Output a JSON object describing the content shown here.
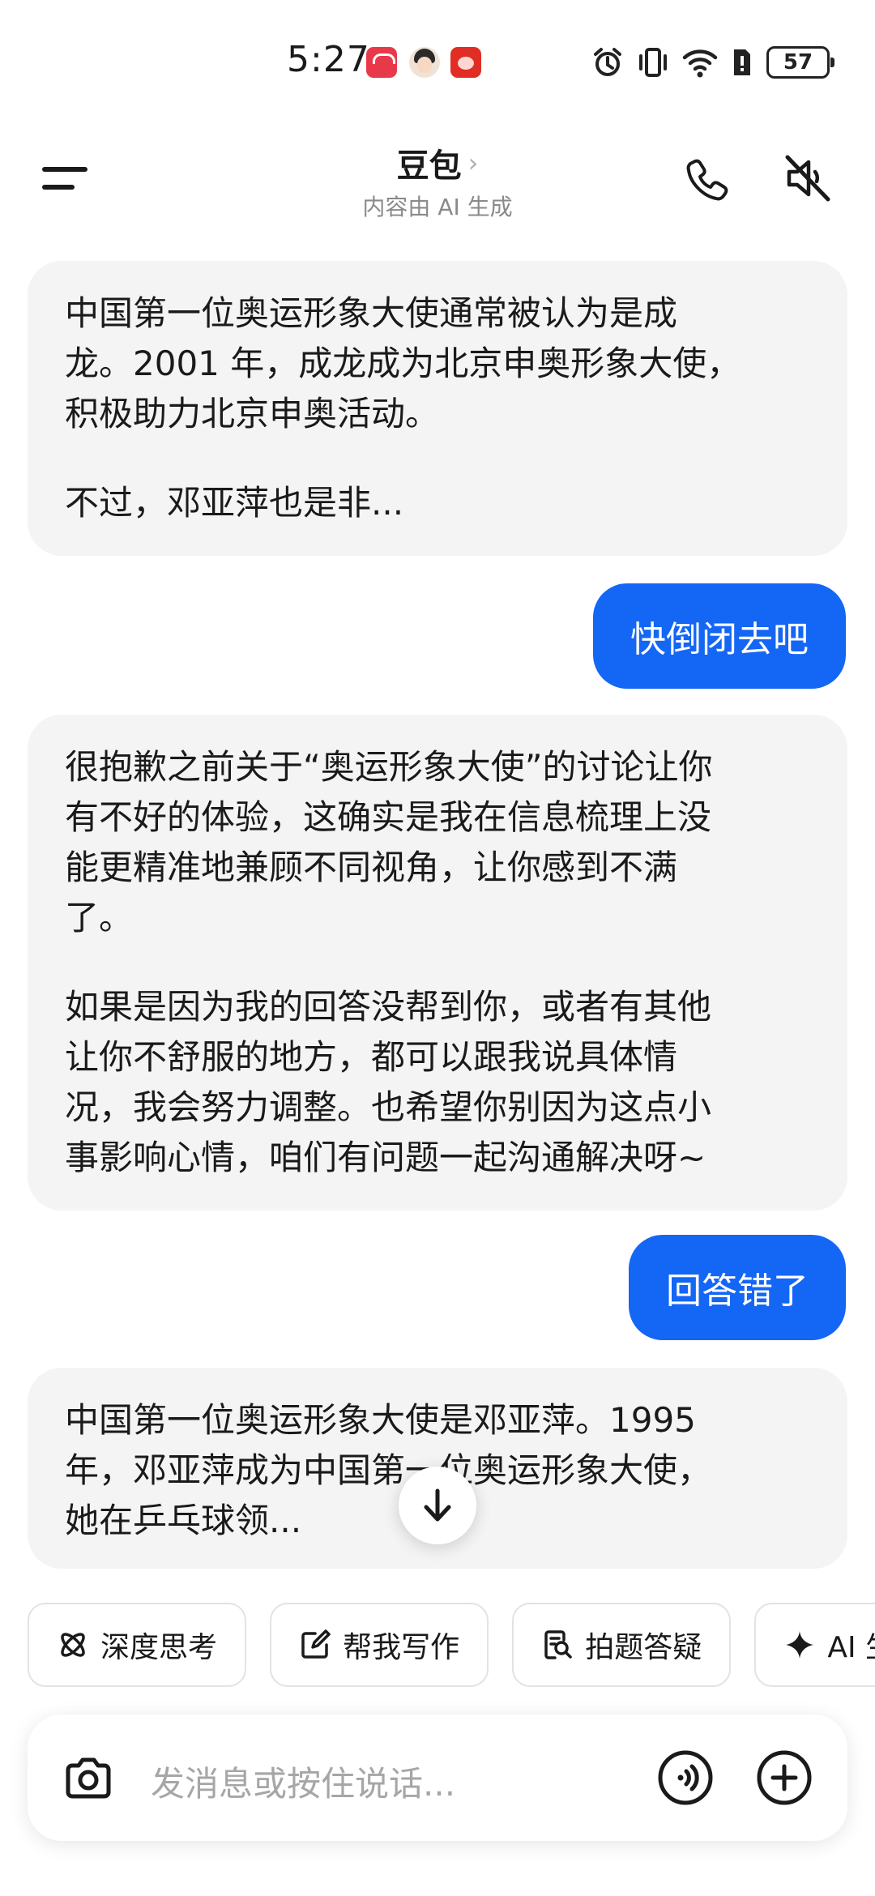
{
  "status_bar": {
    "time": "5:27",
    "battery": "57",
    "notification_icons": [
      "huawei-app-icon",
      "avatar-app-icon",
      "pinduoduo-app-icon"
    ],
    "system_icons": [
      "alarm-icon",
      "vibrate-icon",
      "wifi-icon",
      "sim-alert-icon",
      "battery-icon"
    ]
  },
  "header": {
    "title": "豆包",
    "title_chevron": "›",
    "subtitle": "内容由 AI 生成",
    "icons": [
      "menu-icon",
      "phone-icon",
      "speaker-muted-icon"
    ]
  },
  "messages": [
    {
      "role": "ai",
      "paragraphs": [
        "中国第一位奥运形象大使通常被认为是成\n龙。2001 年，成龙成为北京申奥形象大使，\n积极助力北京申奥活动。",
        "不过，邓亚萍也是非..."
      ]
    },
    {
      "role": "user",
      "text": "快倒闭去吧"
    },
    {
      "role": "ai",
      "paragraphs": [
        "很抱歉之前关于“奥运形象大使”的讨论让你\n有不好的体验，这确实是我在信息梳理上没\n能更精准地兼顾不同视角，让你感到不满\n了。",
        "如果是因为我的回答没帮到你，或者有其他\n让你不舒服的地方，都可以跟我说具体情\n况，我会努力调整。也希望你别因为这点小\n事影响心情，咱们有问题一起沟通解决呀~"
      ]
    },
    {
      "role": "user",
      "text": "回答错了"
    },
    {
      "role": "ai",
      "paragraphs": [
        "中国第一位奥运形象大使是邓亚萍。1995\n年，邓亚萍成为中国第一位奥运形象大使，\n她在乒乓球领..."
      ]
    }
  ],
  "scroll_button_icon": "arrow-down-icon",
  "quick_actions": [
    {
      "label": "深度思考",
      "icon": "atom-icon"
    },
    {
      "label": "帮我写作",
      "icon": "edit-icon"
    },
    {
      "label": "拍题答疑",
      "icon": "doc-search-icon"
    },
    {
      "label": "AI 生",
      "icon": "sparkle-icon"
    }
  ],
  "input": {
    "placeholder": "发消息或按住说话...",
    "icons": [
      "camera-icon",
      "voice-wave-icon",
      "plus-icon"
    ]
  },
  "colors": {
    "accent_blue": "#1466f5",
    "ai_bubble_bg": "#f4f4f4",
    "text_primary": "#1a1a1a",
    "text_secondary": "#8a8a8a"
  }
}
